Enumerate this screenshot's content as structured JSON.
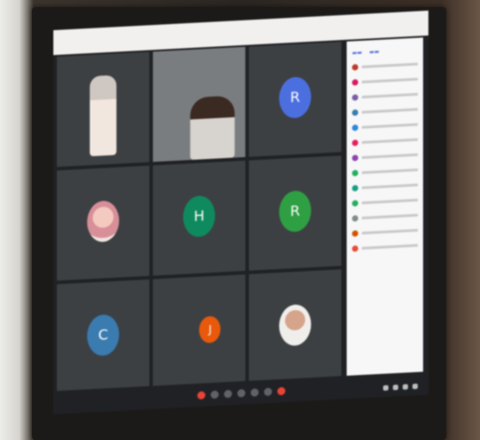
{
  "participants": [
    {
      "initial": "",
      "name": "",
      "kind": "photo-tile"
    },
    {
      "initial": "",
      "name": "",
      "kind": "video"
    },
    {
      "initial": "R",
      "name": "",
      "color": "#4c6fe0",
      "kind": "avatar"
    },
    {
      "initial": "",
      "name": "",
      "kind": "photo"
    },
    {
      "initial": "H",
      "name": "",
      "color": "#0f8a5f",
      "kind": "avatar"
    },
    {
      "initial": "R",
      "name": "",
      "color": "#2ea043",
      "kind": "avatar"
    },
    {
      "initial": "C",
      "name": "",
      "color": "#3a7bb0",
      "kind": "avatar"
    },
    {
      "initial": "J",
      "name": "",
      "color": "#e8590c",
      "kind": "avatar"
    },
    {
      "initial": "",
      "name": "",
      "kind": "photo2"
    }
  ],
  "side_panel": {
    "dots": [
      "#c0392b",
      "#d81b60",
      "#7b5ea7",
      "#3a7bb0",
      "#2e86de",
      "#e91e63",
      "#8e44ad",
      "#27ae60",
      "#16a085",
      "#27ae60",
      "#7f8c8d",
      "#d35400",
      "#e74c3c"
    ]
  },
  "colors": {
    "red_button": "#ea4335"
  }
}
